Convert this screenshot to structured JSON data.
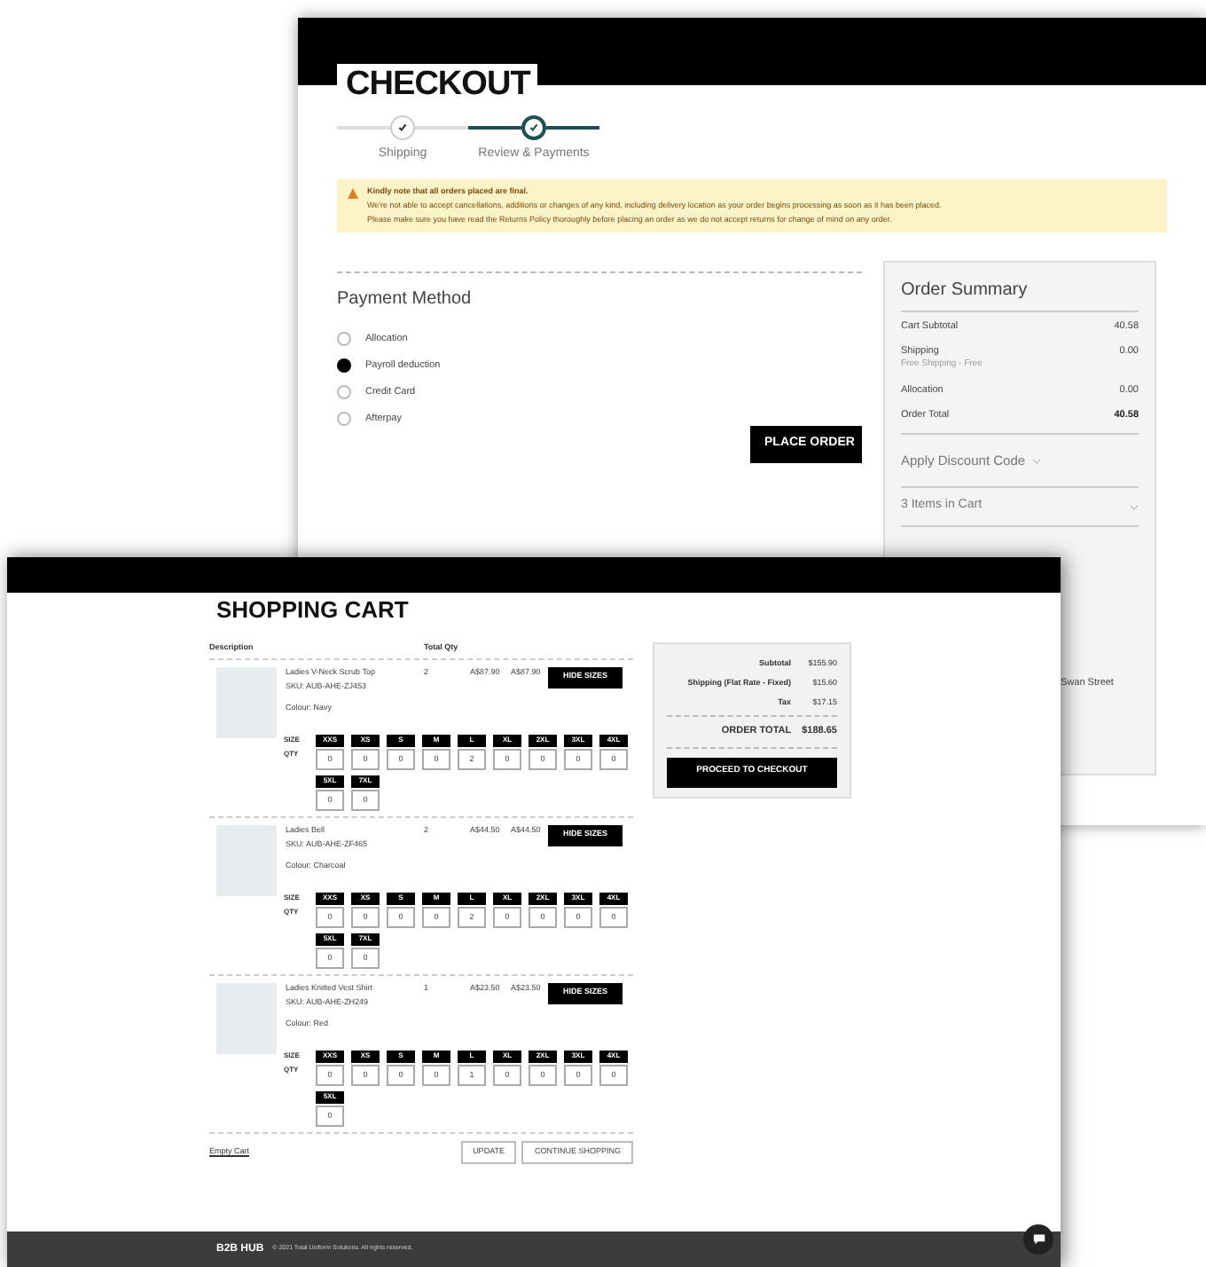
{
  "checkout": {
    "title": "CHECKOUT",
    "steps": [
      {
        "label": "Shipping",
        "selected": false
      },
      {
        "label": "Review & Payments",
        "selected": true
      }
    ],
    "notice": {
      "heading": "Kindly note that all orders placed are final.",
      "lines": [
        "We're not able to accept cancellations, additions or changes of any kind, including delivery location as your order begins processing as soon as it has been placed.",
        "Please make sure you have read the Returns Policy thoroughly before placing an order as we do not accept returns for change of mind on any order."
      ]
    },
    "payment": {
      "title": "Payment Method",
      "options": [
        {
          "label": "Allocation",
          "selected": false
        },
        {
          "label": "Payroll deduction",
          "selected": true
        },
        {
          "label": "Credit Card",
          "selected": false
        },
        {
          "label": "Afterpay",
          "selected": false
        }
      ],
      "button": "PLACE ORDER"
    },
    "summary": {
      "title": "Order Summary",
      "rows": [
        {
          "kind": "line",
          "label": "Cart Subtotal",
          "value": "40.58"
        },
        {
          "kind": "line",
          "label": "Shipping",
          "sublabel": "Free Shipping - Free",
          "value": "0.00"
        },
        {
          "kind": "line",
          "label": "Allocation",
          "value": "0.00"
        },
        {
          "kind": "total",
          "label": "Order Total",
          "value": "40.58"
        }
      ],
      "discount": "Apply Discount Code",
      "items_in_cart": "3 Items in Cart",
      "address_fragment": "Swan Street"
    }
  },
  "cart": {
    "title": "SHOPPING CART",
    "columns": [
      "Description",
      "Total Qty"
    ],
    "items": [
      {
        "name": "Ladies V-Neck Scrub Top",
        "sku": "SKU: AUB-AHE-ZJ453",
        "colour": "Colour: Navy",
        "qty": "2",
        "price": "A$87.90",
        "total": "A$87.90",
        "button": "HIDE SIZES",
        "size_label": "SIZE",
        "qty_label": "QTY",
        "sizes": [
          {
            "label": "XXS",
            "qty": "0"
          },
          {
            "label": "XS",
            "qty": "0"
          },
          {
            "label": "S",
            "qty": "0"
          },
          {
            "label": "M",
            "qty": "0"
          },
          {
            "label": "L",
            "qty": "2"
          },
          {
            "label": "XL",
            "qty": "0"
          },
          {
            "label": "2XL",
            "qty": "0"
          },
          {
            "label": "3XL",
            "qty": "0"
          },
          {
            "label": "4XL",
            "qty": "0"
          },
          {
            "label": "5XL",
            "qty": "0"
          },
          {
            "label": "7XL",
            "qty": "0"
          }
        ]
      },
      {
        "name": "Ladies Bell",
        "sku": "SKU: AUB-AHE-ZF465",
        "colour": "Colour: Charcoal",
        "qty": "2",
        "price": "A$44.50",
        "total": "A$44.50",
        "button": "HIDE SIZES",
        "size_label": "SIZE",
        "qty_label": "QTY",
        "sizes": [
          {
            "label": "XXS",
            "qty": "0"
          },
          {
            "label": "XS",
            "qty": "0"
          },
          {
            "label": "S",
            "qty": "0"
          },
          {
            "label": "M",
            "qty": "0"
          },
          {
            "label": "L",
            "qty": "2"
          },
          {
            "label": "XL",
            "qty": "0"
          },
          {
            "label": "2XL",
            "qty": "0"
          },
          {
            "label": "3XL",
            "qty": "0"
          },
          {
            "label": "4XL",
            "qty": "0"
          },
          {
            "label": "5XL",
            "qty": "0"
          },
          {
            "label": "7XL",
            "qty": "0"
          }
        ]
      },
      {
        "name": "Ladies Knitted Vest Shirt",
        "sku": "SKU: AUB-AHE-ZH249",
        "colour": "Colour: Red",
        "qty": "1",
        "price": "A$23.50",
        "total": "A$23.50",
        "button": "HIDE SIZES",
        "size_label": "SIZE",
        "qty_label": "QTY",
        "sizes": [
          {
            "label": "XXS",
            "qty": "0"
          },
          {
            "label": "XS",
            "qty": "0"
          },
          {
            "label": "S",
            "qty": "0"
          },
          {
            "label": "M",
            "qty": "0"
          },
          {
            "label": "L",
            "qty": "1"
          },
          {
            "label": "XL",
            "qty": "0"
          },
          {
            "label": "2XL",
            "qty": "0"
          },
          {
            "label": "3XL",
            "qty": "0"
          },
          {
            "label": "4XL",
            "qty": "0"
          },
          {
            "label": "5XL",
            "qty": "0"
          }
        ]
      }
    ],
    "empty_link": "Empty Cart",
    "buttons": [
      "UPDATE",
      "CONTINUE SHOPPING"
    ],
    "summary": {
      "rows": [
        {
          "label": "Subtotal",
          "value": "$155.90"
        },
        {
          "label": "Shipping (Flat Rate - Fixed)",
          "value": "$15.60"
        },
        {
          "label": "Tax",
          "value": "$17.15"
        }
      ],
      "total_label": "ORDER TOTAL",
      "total_value": "$188.65",
      "button": "PROCEED TO CHECKOUT"
    }
  },
  "footer": {
    "logo": "B2B HUB",
    "copyright": "© 2021 Total Uniform Solutions. All rights reserved."
  }
}
